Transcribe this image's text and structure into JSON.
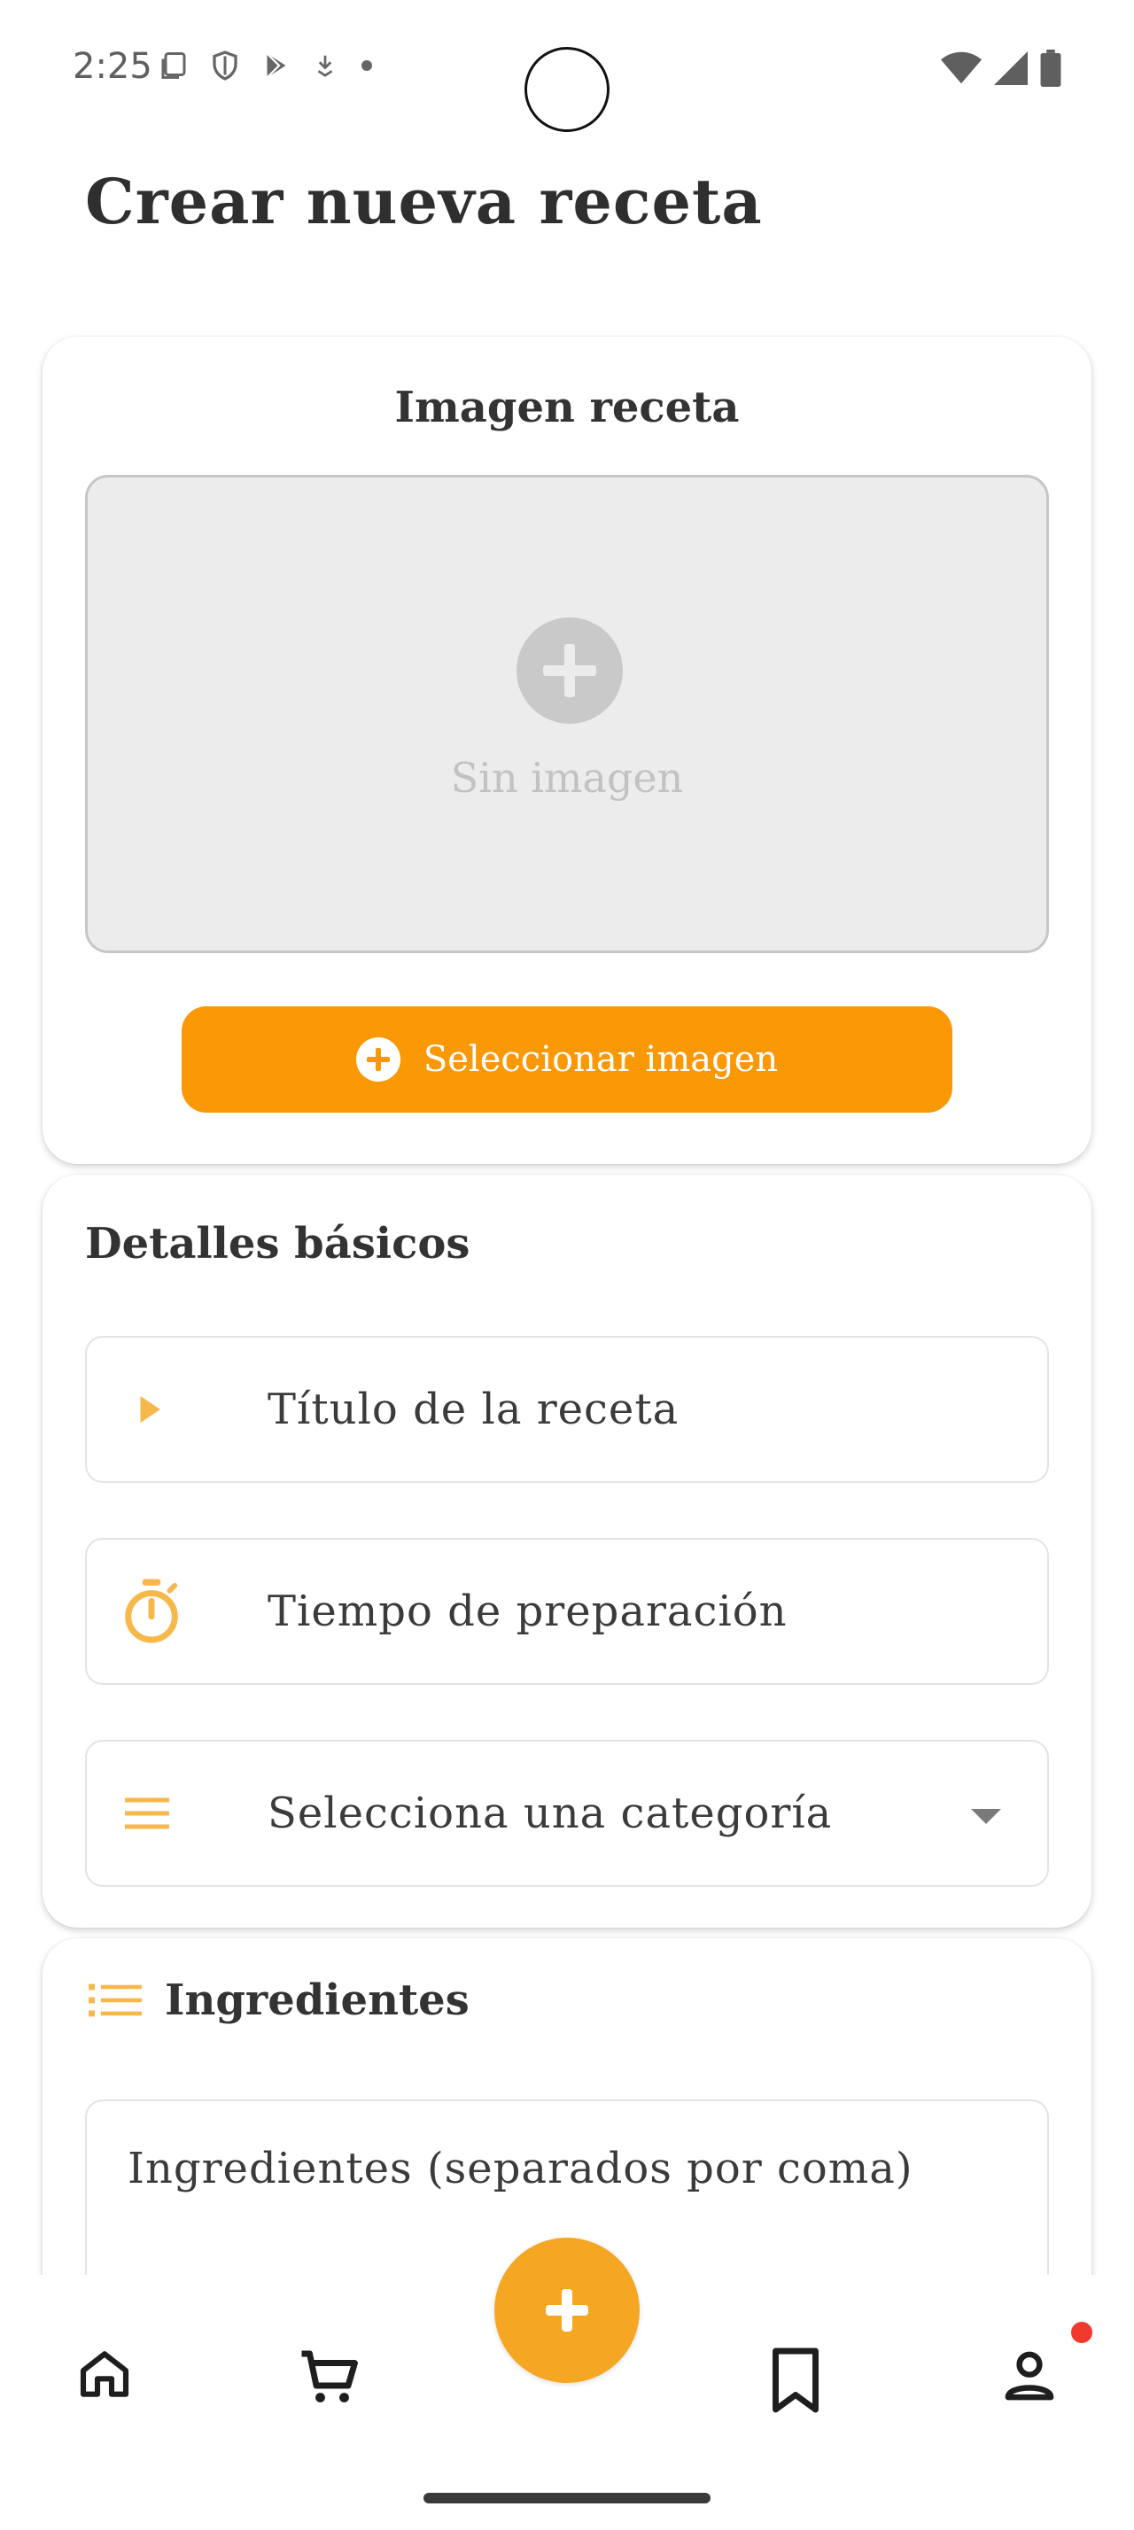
{
  "status_bar": {
    "time": "2:25",
    "left_icons": [
      "screenshot-icon",
      "shield-icon",
      "play-store-icon",
      "download-icon",
      "dot-icon"
    ],
    "right_icons": [
      "wifi-icon",
      "signal-icon",
      "battery-icon"
    ]
  },
  "page": {
    "title": "Crear nueva receta"
  },
  "image_card": {
    "title": "Imagen receta",
    "placeholder_text": "Sin imagen",
    "select_button_label": "Seleccionar imagen"
  },
  "basic_card": {
    "title": "Detalles básicos",
    "fields": [
      {
        "placeholder": "Título de la receta",
        "icon": "play-arrow-icon"
      },
      {
        "placeholder": "Tiempo de preparación",
        "icon": "timer-icon"
      },
      {
        "placeholder": "Selecciona una categoría",
        "icon": "menu-lines-icon"
      }
    ]
  },
  "ingredients_card": {
    "title": "Ingredientes",
    "placeholder": "Ingredientes (separados por coma)"
  },
  "bottom_nav": {
    "items": [
      "home-icon",
      "cart-icon",
      "add-icon",
      "bookmark-icon",
      "profile-icon"
    ],
    "accent": "#f5a623",
    "notification_dot_color": "#f03a2e"
  },
  "colors": {
    "primary": "#fa9805",
    "icon_accent": "#f7b84b"
  }
}
